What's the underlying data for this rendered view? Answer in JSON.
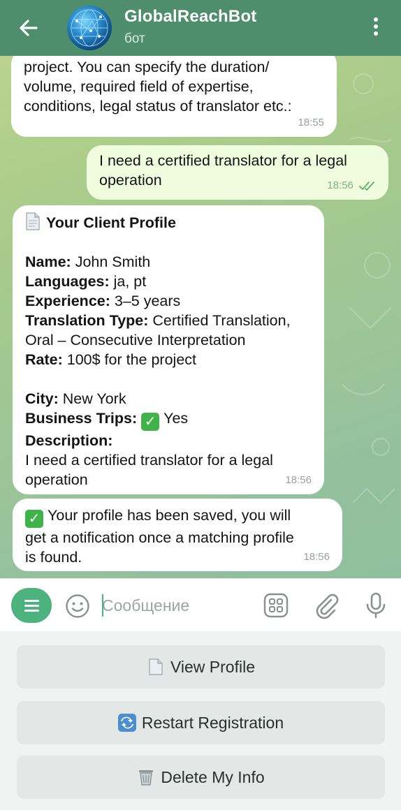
{
  "header": {
    "title": "GlobalReachBot",
    "subtitle": "бот"
  },
  "messages": {
    "m1": {
      "lines": [
        "project. You can specify the duration/",
        "volume, required field of expertise,",
        "conditions, legal status of translator etc.:"
      ],
      "time": "18:55"
    },
    "m2": {
      "lines": [
        "I need a certified translator for a legal",
        "operation"
      ],
      "time": "18:56"
    },
    "m3": {
      "heading": "Your Client Profile",
      "name_label": "Name:",
      "name_value": " John Smith",
      "languages_label": "Languages:",
      "languages_value": " ja, pt",
      "experience_label": "Experience:",
      "experience_value": " 3–5 years",
      "type_label": "Translation Type:",
      "type_value": " Certified Translation,",
      "type_value2": "Oral – Consecutive Interpretation",
      "rate_label": "Rate:",
      "rate_value": " 100$ for the project",
      "city_label": "City:",
      "city_value": " New York",
      "trips_label": "Business Trips:",
      "trips_value": "Yes",
      "desc_label": "Description:",
      "desc_lines": [
        "I need a certified translator for a legal",
        "operation"
      ],
      "time": "18:56"
    },
    "m4": {
      "lines": [
        "Your profile has been saved, you will",
        "get a notification once a matching profile",
        "is found."
      ],
      "time": "18:56"
    }
  },
  "input": {
    "placeholder": "Сообщение"
  },
  "keyboard": {
    "view_profile": "View Profile",
    "restart": "Restart Registration",
    "delete": "Delete My Info"
  },
  "colors": {
    "header": "#4f8e6c",
    "accent": "#4cb27e",
    "outgoing_bubble": "#effdde",
    "incoming_bubble": "#ffffff"
  }
}
